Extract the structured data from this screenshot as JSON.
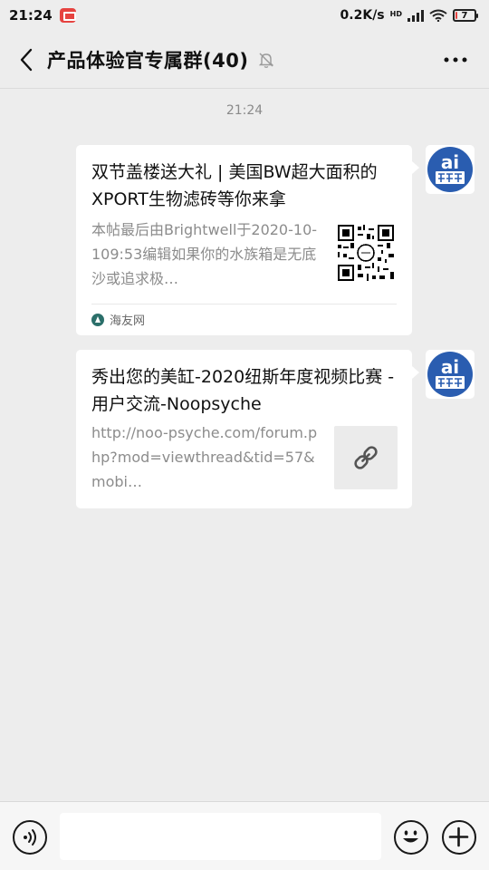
{
  "status_bar": {
    "time": "21:24",
    "network_speed": "0.2K/s",
    "network_type": "HD",
    "battery_level": "7",
    "battery_fraction": 0.07
  },
  "header": {
    "title": "产品体验官专属群(40)",
    "back_icon": "chevron-left-icon",
    "mute_icon": "bell-off-icon",
    "more_icon": "more-horizontal-icon"
  },
  "chat": {
    "timestamp": "21:24",
    "messages": [
      {
        "title": "双节盖楼送大礼 | 美国BW超大面积的XPORT生物滤砖等你来拿",
        "desc": "本帖最后由Brightwell于2020-10-109:53编辑如果你的水族箱是无底沙或追求极…",
        "source": "海友网",
        "thumb_icon": "qr-code-icon",
        "avatar_icon": "avatar-ai-icon"
      },
      {
        "title": "秀出您的美缸-2020纽斯年度视频比赛 - 用户交流-Noopsyche",
        "desc": "http://noo-psyche.com/forum.php?mod=viewthread&tid=57&mobi…",
        "thumb_icon": "link-icon",
        "avatar_icon": "avatar-ai-icon"
      }
    ]
  },
  "input_bar": {
    "voice_icon": "voice-icon",
    "input_value": "",
    "emoji_icon": "emoji-icon",
    "plus_icon": "plus-icon"
  },
  "colors": {
    "background": "#ededed",
    "bubble": "#ffffff",
    "avatar_blue": "#2a5db0",
    "battery_low": "#e64340"
  }
}
